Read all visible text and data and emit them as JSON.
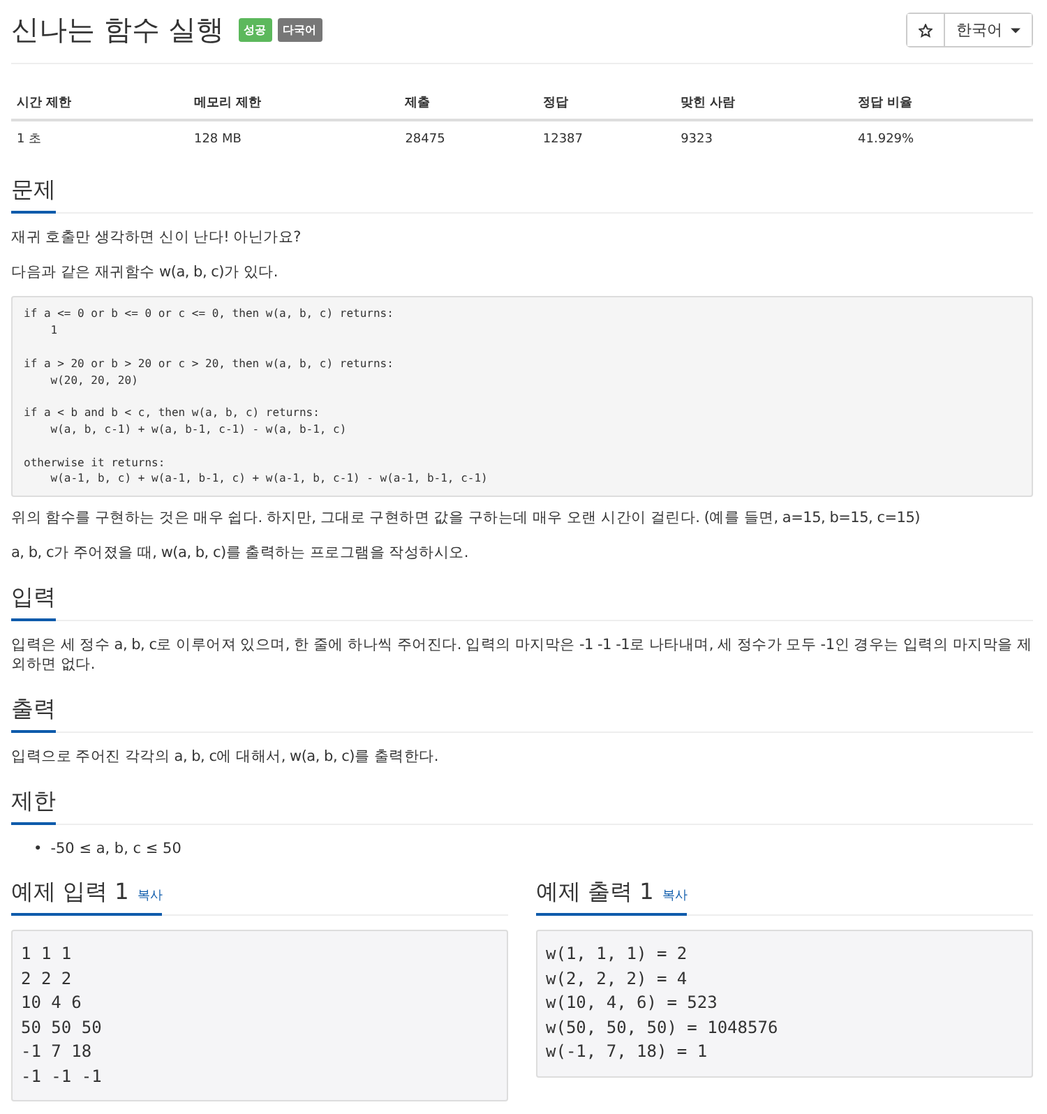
{
  "title": "신나는 함수 실행",
  "badges": [
    {
      "label": "성공",
      "color": "#5cb85c"
    },
    {
      "label": "다국어",
      "color": "#777777"
    }
  ],
  "language_dropdown": {
    "value": "한국어"
  },
  "stats": {
    "columns": [
      "시간 제한",
      "메모리 제한",
      "제출",
      "정답",
      "맞힌 사람",
      "정답 비율"
    ],
    "rows": [
      [
        "1 초",
        "128 MB",
        "28475",
        "12387",
        "9323",
        "41.929%"
      ]
    ]
  },
  "sections": [
    {
      "heading": "문제",
      "blocks": [
        {
          "kind": "paragraph",
          "text": "재귀 호출만 생각하면 신이 난다! 아닌가요?"
        },
        {
          "kind": "paragraph",
          "text": "다음과 같은 재귀함수 w(a, b, c)가 있다."
        },
        {
          "kind": "code",
          "text": "if a <= 0 or b <= 0 or c <= 0, then w(a, b, c) returns:\n    1\n\nif a > 20 or b > 20 or c > 20, then w(a, b, c) returns:\n    w(20, 20, 20)\n\nif a < b and b < c, then w(a, b, c) returns:\n    w(a, b, c-1) + w(a, b-1, c-1) - w(a, b-1, c)\n\notherwise it returns:\n    w(a-1, b, c) + w(a-1, b-1, c) + w(a-1, b, c-1) - w(a-1, b-1, c-1)"
        },
        {
          "kind": "paragraph",
          "text": "위의 함수를 구현하는 것은 매우 쉽다. 하지만, 그대로 구현하면 값을 구하는데 매우 오랜 시간이 걸린다. (예를 들면, a=15, b=15, c=15)"
        },
        {
          "kind": "paragraph",
          "text": "a, b, c가 주어졌을 때, w(a, b, c)를 출력하는 프로그램을 작성하시오."
        }
      ]
    },
    {
      "heading": "입력",
      "blocks": [
        {
          "kind": "paragraph",
          "text": "입력은 세 정수 a, b, c로 이루어져 있으며, 한 줄에 하나씩 주어진다. 입력의 마지막은 -1 -1 -1로 나타내며, 세 정수가 모두 -1인 경우는 입력의 마지막을 제외하면 없다."
        }
      ]
    },
    {
      "heading": "출력",
      "blocks": [
        {
          "kind": "paragraph",
          "text": "입력으로 주어진 각각의 a, b, c에 대해서, w(a, b, c)를 출력한다."
        }
      ]
    },
    {
      "heading": "제한",
      "blocks": [
        {
          "kind": "bullet",
          "marker": "•",
          "text": "-50 ≤ a, b, c ≤ 50"
        }
      ]
    }
  ],
  "samples": [
    {
      "heading": "예제 입력 1",
      "copy_link": "복사",
      "text": "1 1 1\n2 2 2\n10 4 6\n50 50 50\n-1 7 18\n-1 -1 -1"
    },
    {
      "heading": "예제 출력 1",
      "copy_link": "복사",
      "text": "w(1, 1, 1) = 2\nw(2, 2, 2) = 4\nw(10, 4, 6) = 523\nw(50, 50, 50) = 1048576\nw(-1, 7, 18) = 1"
    }
  ]
}
